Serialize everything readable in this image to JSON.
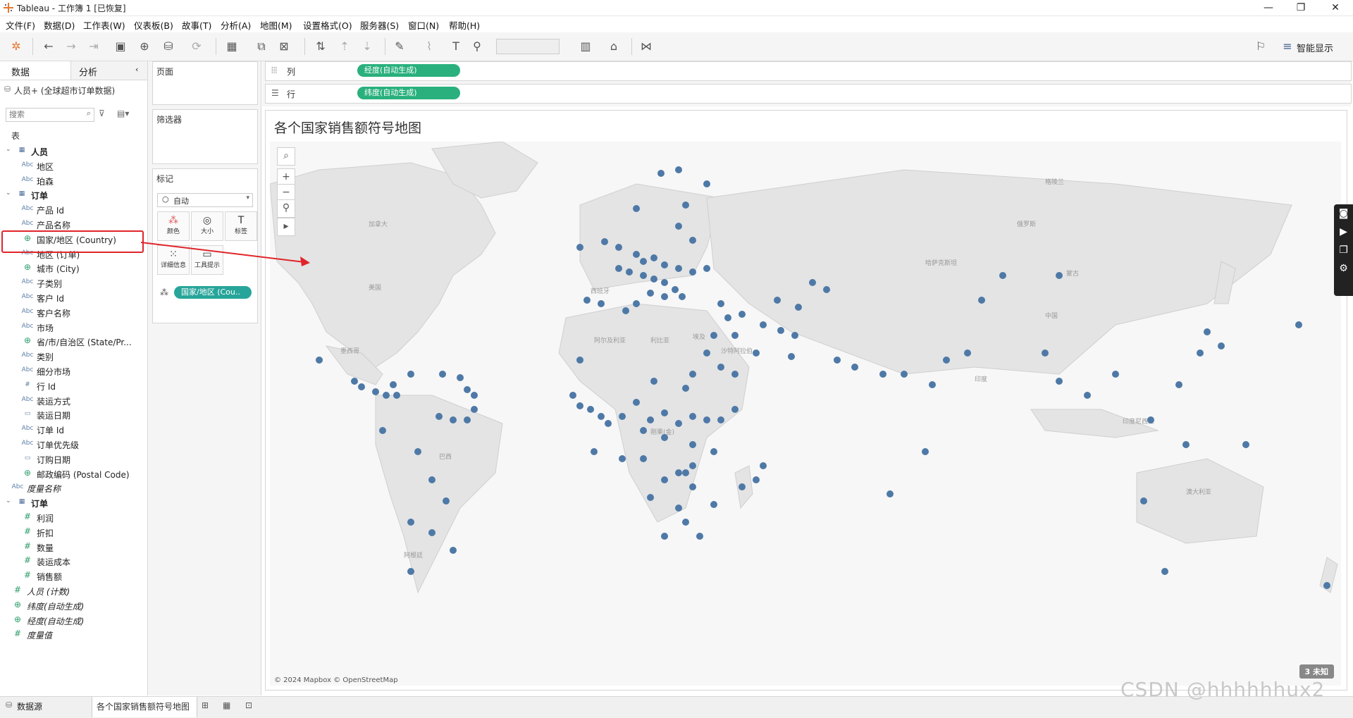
{
  "window": {
    "title": "Tableau - 工作簿 1 [已恢复]",
    "controls": [
      "—",
      "❐",
      "✕"
    ]
  },
  "menu": [
    "文件(F)",
    "数据(D)",
    "工作表(W)",
    "仪表板(B)",
    "故事(T)",
    "分析(A)",
    "地图(M)",
    "设置格式(O)",
    "服务器(S)",
    "窗口(N)",
    "帮助(H)"
  ],
  "toolbar": {
    "show_me": "智能显示"
  },
  "left_pane": {
    "tabs": [
      "数据",
      "分析"
    ],
    "datasource": "人员+ (全球超市订单数据)",
    "search_placeholder": "搜索",
    "section_label": "表",
    "fields": [
      {
        "type": "table",
        "label": "人员"
      },
      {
        "type": "abc",
        "label": "地区"
      },
      {
        "type": "abc",
        "label": "珀森"
      },
      {
        "type": "table",
        "label": "订单"
      },
      {
        "type": "abc",
        "label": "产品 Id"
      },
      {
        "type": "abc",
        "label": "产品名称"
      },
      {
        "type": "geo",
        "label": "国家/地区 (Country)"
      },
      {
        "type": "abc",
        "label": "地区 (订单)"
      },
      {
        "type": "geo",
        "label": "城市 (City)"
      },
      {
        "type": "abc",
        "label": "子类别"
      },
      {
        "type": "abc",
        "label": "客户 Id"
      },
      {
        "type": "abc",
        "label": "客户名称"
      },
      {
        "type": "abc",
        "label": "市场"
      },
      {
        "type": "geo",
        "label": "省/市/自治区 (State/Pr..."
      },
      {
        "type": "abc",
        "label": "类别"
      },
      {
        "type": "abc",
        "label": "细分市场"
      },
      {
        "type": "num",
        "label": "行 Id"
      },
      {
        "type": "abc",
        "label": "装运方式"
      },
      {
        "type": "date",
        "label": "装运日期"
      },
      {
        "type": "abc",
        "label": "订单 Id"
      },
      {
        "type": "abc",
        "label": "订单优先级"
      },
      {
        "type": "date",
        "label": "订购日期"
      },
      {
        "type": "geo",
        "label": "邮政编码 (Postal Code)"
      },
      {
        "type": "abc-italic",
        "label": "度量名称"
      },
      {
        "type": "table",
        "label": "订单"
      },
      {
        "type": "measure",
        "label": "利润"
      },
      {
        "type": "measure",
        "label": "折扣"
      },
      {
        "type": "measure",
        "label": "数量"
      },
      {
        "type": "measure",
        "label": "装运成本"
      },
      {
        "type": "measure",
        "label": "销售额"
      },
      {
        "type": "measure-italic",
        "label": "人员 (计数)"
      },
      {
        "type": "geo-italic",
        "label": "纬度(自动生成)"
      },
      {
        "type": "geo-italic",
        "label": "经度(自动生成)"
      },
      {
        "type": "measure-italic",
        "label": "度量值"
      }
    ]
  },
  "shelves": {
    "pages_label": "页面",
    "filters_label": "筛选器",
    "marks_label": "标记",
    "marks_type": "自动",
    "mark_buttons": [
      "颜色",
      "大小",
      "标签",
      "详细信息",
      "工具提示"
    ],
    "detail_pill": "国家/地区 (Cou..",
    "columns_label": "列",
    "rows_label": "行",
    "columns_pill": "经度(自动生成)",
    "rows_pill": "纬度(自动生成)"
  },
  "viz": {
    "title": "各个国家销售额符号地图",
    "attribution": "© 2024 Mapbox © OpenStreetMap",
    "unknown_badge": "3 未知",
    "dot_color": "#4e79a7"
  },
  "status": {
    "datasource_tab": "数据源",
    "sheet_tab": "各个国家销售额符号地图"
  },
  "watermark": "CSDN @hhhhhhux2",
  "map_labels": [
    "格陵兰",
    "俄罗斯",
    "哈萨克斯坦",
    "中国",
    "美国",
    "墨西哥",
    "巴西",
    "阿根廷",
    "阿尔及利亚",
    "利比亚",
    "埃及",
    "沙特阿拉伯",
    "印度",
    "印度尼西亚",
    "澳大利亚",
    "刚果(金)",
    "西班牙",
    "加拿大",
    "蒙古"
  ]
}
